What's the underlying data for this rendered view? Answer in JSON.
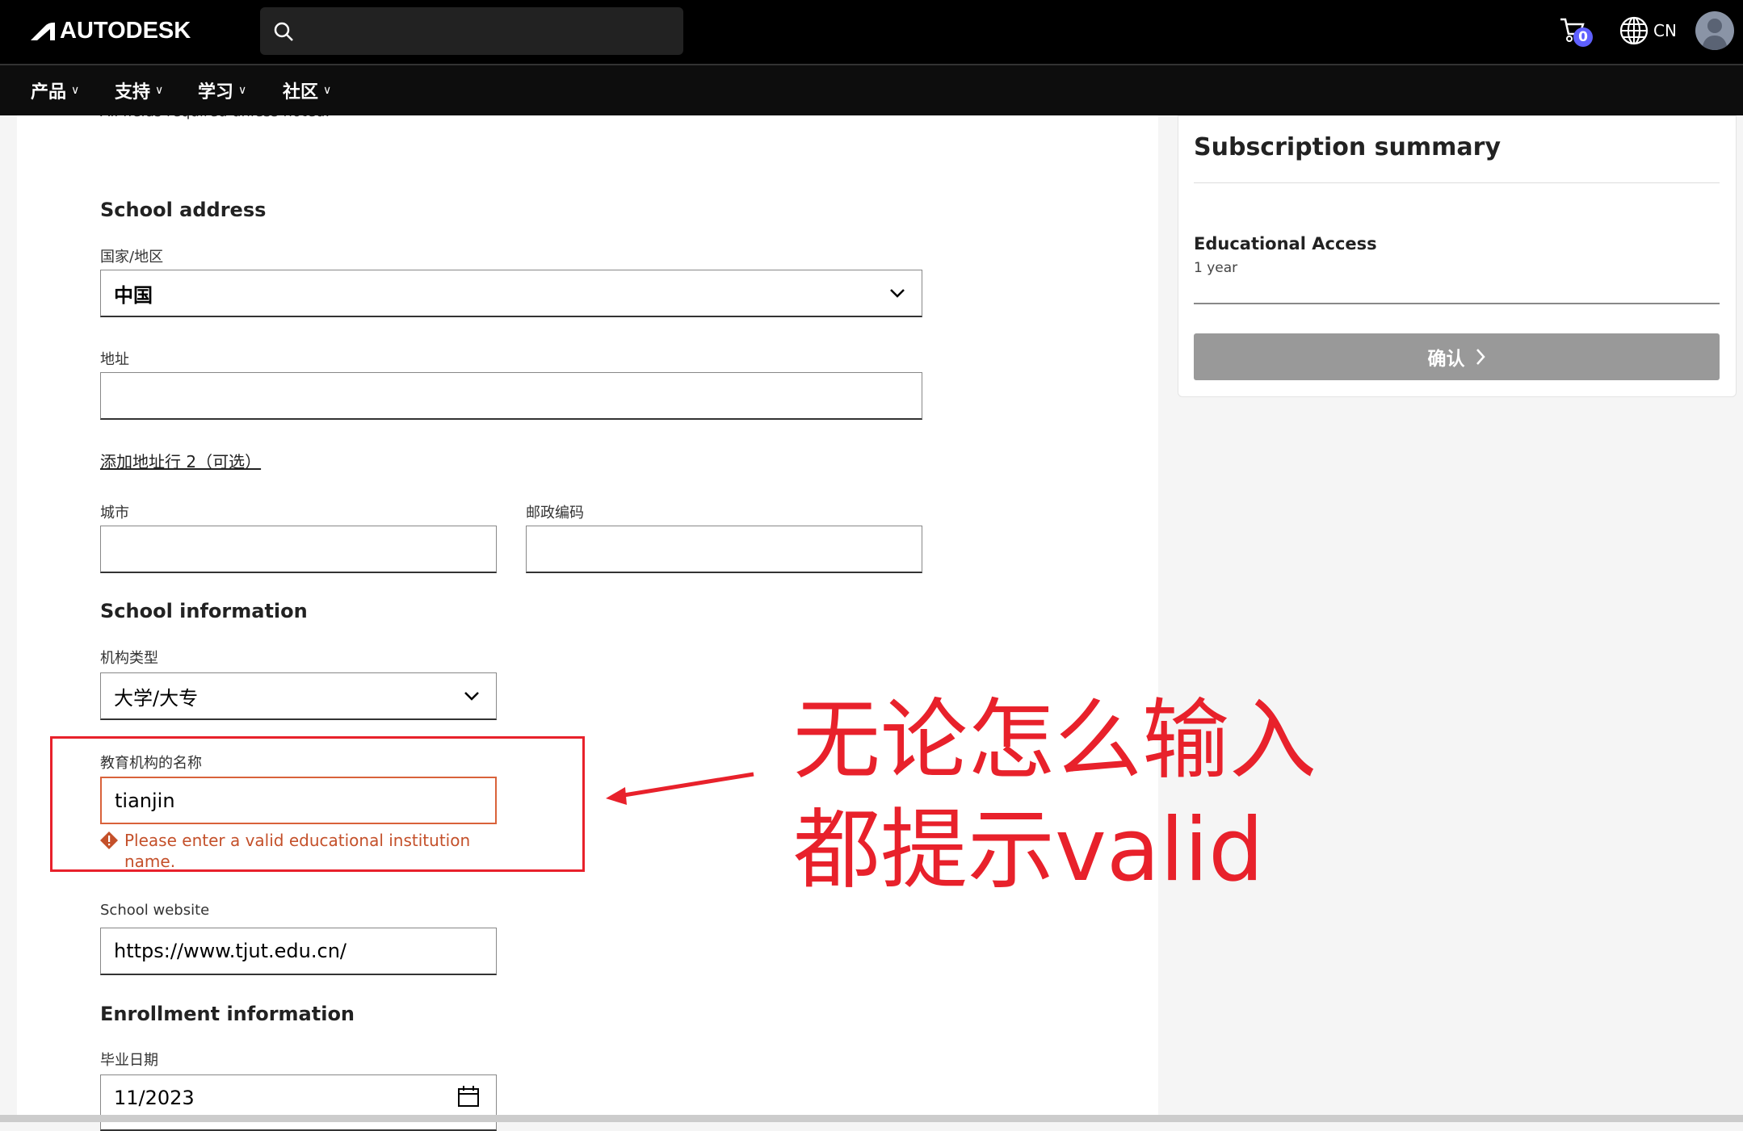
{
  "header": {
    "logo": "AUTODESK",
    "search_placeholder": "",
    "cart_count": "0",
    "region": "CN"
  },
  "nav": [
    {
      "label": "产品"
    },
    {
      "label": "支持"
    },
    {
      "label": "学习"
    },
    {
      "label": "社区"
    }
  ],
  "form": {
    "note": "All fields required unless noted.",
    "school_address_title": "School address",
    "country_label": "国家/地区",
    "country_value": "中国",
    "address_label": "地址",
    "address_value": "",
    "add_line2_link": "添加地址行 2（可选）",
    "city_label": "城市",
    "city_value": "",
    "postal_label": "邮政编码",
    "postal_value": "",
    "school_info_title": "School information",
    "inst_type_label": "机构类型",
    "inst_type_value": "大学/大专",
    "inst_name_label": "教育机构的名称",
    "inst_name_value": "tianjin",
    "inst_name_error": "Please enter a valid educational institution name.",
    "website_label": "School website",
    "website_value": "https://www.tjut.edu.cn/",
    "enrollment_title": "Enrollment information",
    "grad_date_label": "毕业日期",
    "grad_date_value": "11/2023"
  },
  "summary": {
    "title": "Subscription summary",
    "product": "Educational Access",
    "term": "1 year",
    "confirm_button": "确认"
  },
  "annotation": {
    "line1": "无论怎么输入",
    "line2": "都提示valid",
    "color": "#e8212b"
  },
  "colors": {
    "error": "#c4502a",
    "badge": "#5f60ff",
    "button_disabled": "#999999"
  }
}
